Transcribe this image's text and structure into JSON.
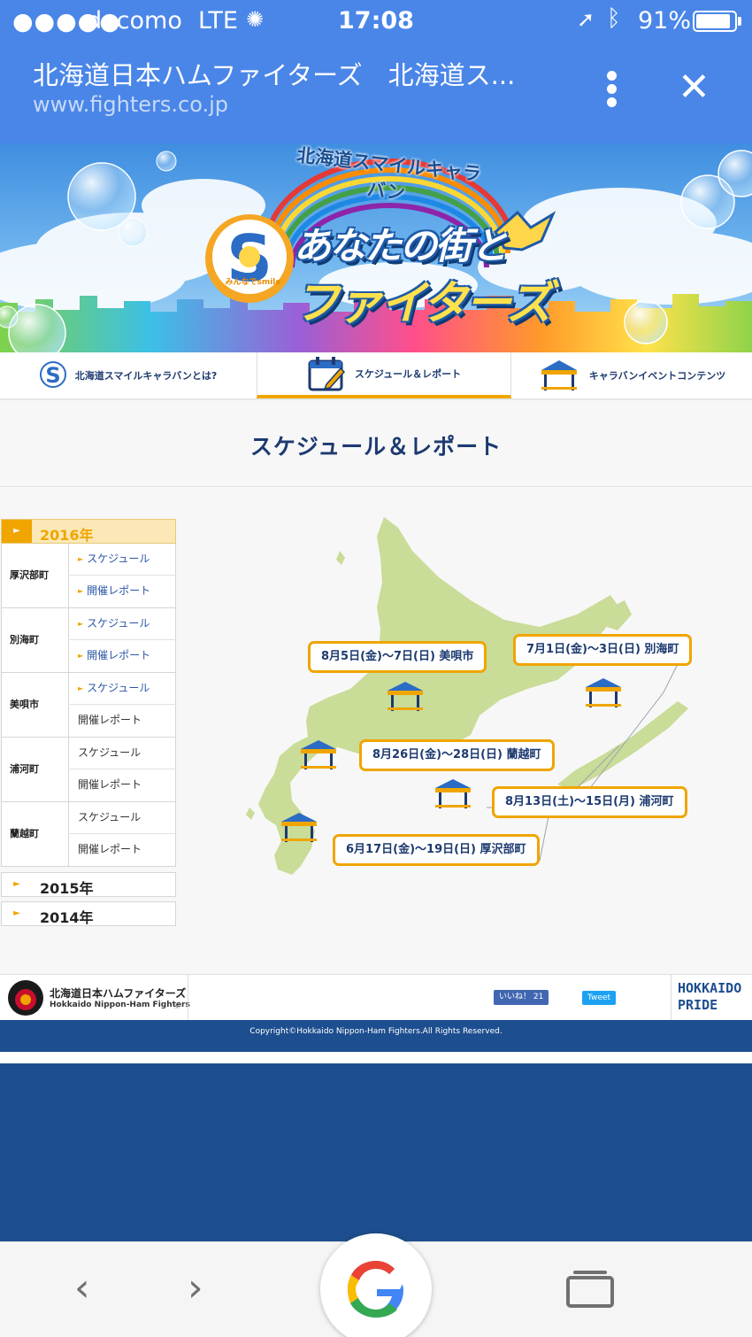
{
  "status_bar": {
    "signal": "●●●●●",
    "carrier": "docomo",
    "network": "LTE",
    "time": "17:08",
    "battery": "91%"
  },
  "browser": {
    "page_title": "北海道日本ハムファイターズ　北海道ス...",
    "url": "www.fighters.co.jp"
  },
  "banner": {
    "subtitle": "北海道スマイルキャラバン",
    "title_line1": "あなたの街と",
    "title_line2": "ファイターズ",
    "logo_caption": "みんなでsmile"
  },
  "nav": {
    "tabs": [
      {
        "label": "北海道スマイルキャラバンとは?"
      },
      {
        "label": "スケジュール＆レポート"
      },
      {
        "label": "キャラバンイベントコンテンツ"
      }
    ]
  },
  "page": {
    "heading": "スケジュール＆レポート"
  },
  "sidebar": {
    "active_year": "2016年",
    "towns": [
      {
        "name": "厚沢部町",
        "link1": "スケジュール",
        "link2": "開催レポート"
      },
      {
        "name": "別海町",
        "link1": "スケジュール",
        "link2": "開催レポート"
      },
      {
        "name": "美唄市",
        "link1": "スケジュール",
        "link2": "開催レポート"
      },
      {
        "name": "浦河町",
        "link1": "スケジュール",
        "link2": "開催レポート"
      },
      {
        "name": "蘭越町",
        "link1": "スケジュール",
        "link2": "開催レポート"
      }
    ],
    "other_years": [
      "2015年",
      "2014年"
    ]
  },
  "map": {
    "events": [
      {
        "label": "8月5日(金)〜7日(日) 美唄市"
      },
      {
        "label": "7月1日(金)〜3日(日) 別海町"
      },
      {
        "label": "8月26日(金)〜28日(日) 蘭越町"
      },
      {
        "label": "8月13日(土)〜15日(月) 浦河町"
      },
      {
        "label": "6月17日(金)〜19日(日) 厚沢部町"
      }
    ]
  },
  "footer": {
    "team_jp": "北海道日本ハムファイターズ",
    "team_en": "Hokkaido Nippon-Ham Fighters",
    "logo_text": "FIGHTERS",
    "like_label": "いいね！ 21",
    "tweet_label": "Tweet",
    "pride_line1": "HOKKAIDO",
    "pride_line2": "PRIDE",
    "copyright": "Copyright©Hokkaido Nippon-Ham Fighters.All Rights Reserved."
  },
  "colors": {
    "chrome_blue": "#4a86e8",
    "accent_orange": "#f0a500",
    "navy": "#1d3a70",
    "footer_blue": "#1d4e8f",
    "map_green": "#c9dc98"
  }
}
